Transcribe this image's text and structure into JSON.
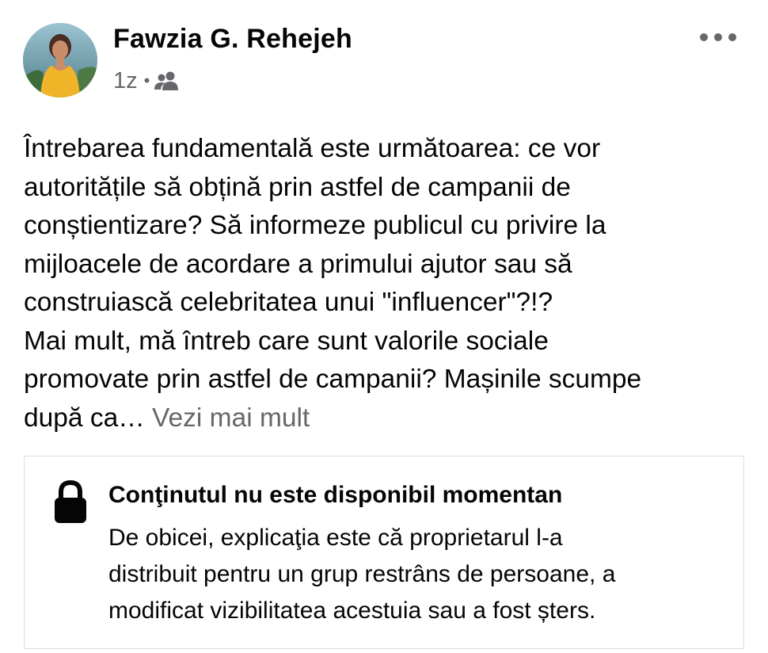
{
  "post": {
    "author": {
      "name": "Fawzia G. Rehejeh",
      "avatar_icon": "profile-photo"
    },
    "meta": {
      "timestamp": "1z",
      "separator": "•",
      "audience_icon": "group-audience-icon"
    },
    "more_icon": "more-options-icon",
    "text_lines": [
      "Întrebarea fundamentală este următoarea: ce vor",
      "autoritățile să obțină prin astfel de campanii de",
      "conștientizare? Să informeze publicul cu privire la",
      "mijloacele de acordare a primului ajutor sau să",
      "construiască celebritatea unui \"influencer\"?!?",
      "Mai mult, mă întreb care sunt valorile sociale",
      "promovate prin astfel de campanii? Mașinile scumpe",
      "după ca…"
    ],
    "see_more_label": "Vezi mai mult"
  },
  "unavailable": {
    "icon": "lock-icon",
    "title": "Conţinutul nu este disponibil momentan",
    "description_lines": [
      "De obicei, explicaţia este că proprietarul l-a",
      "distribuit pentru un grup restrâns de persoane, a",
      "modificat vizibilitatea acestuia sau a fost șters."
    ]
  },
  "colors": {
    "primary_text": "#050505",
    "secondary_text": "#65676b",
    "border": "#dadde1",
    "background": "#ffffff"
  }
}
